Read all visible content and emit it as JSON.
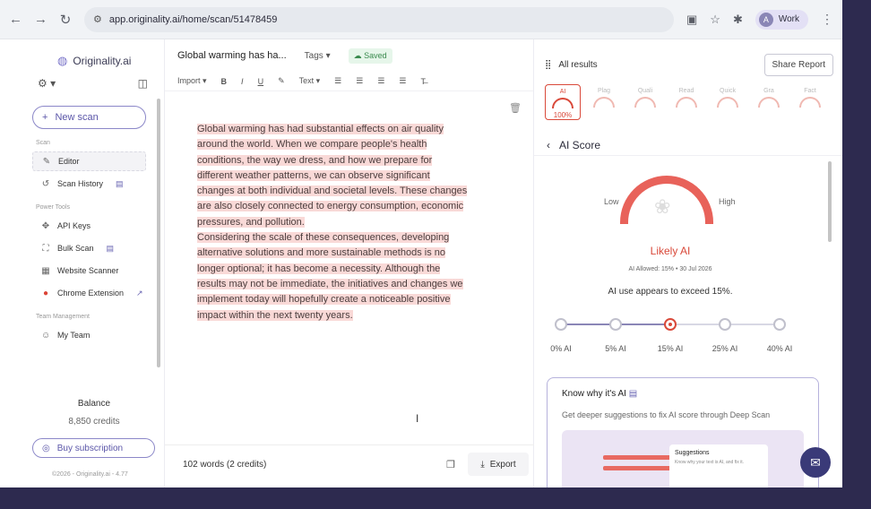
{
  "browser": {
    "url": "app.originality.ai/home/scan/51478459",
    "profile_initial": "A",
    "profile_name": "Work"
  },
  "sidebar": {
    "logo": "Originality.ai",
    "new_scan": "New scan",
    "section_scan": "Scan",
    "editor": "Editor",
    "scan_history": "Scan History",
    "section_power": "Power Tools",
    "api_keys": "API Keys",
    "bulk_scan": "Bulk Scan",
    "website_scanner": "Website Scanner",
    "chrome_extension": "Chrome Extension",
    "section_team": "Team Management",
    "my_team": "My Team",
    "balance_label": "Balance",
    "balance_value": "8,850 credits",
    "buy": "Buy subscription",
    "copyright": "©2026 - Originality.ai - 4.77"
  },
  "editor": {
    "title": "Global warming has ha...",
    "tags": "Tags",
    "saved": "Saved",
    "import": "Import",
    "text_style": "Text",
    "paragraphs": [
      [
        "Global warming has had substantial effects on air quality",
        "around the world. When we compare people's health",
        "conditions, the way we dress, and how we prepare for",
        "different weather patterns, we can observe significant",
        "changes at both individual and societal levels. These changes",
        "are also closely connected to energy consumption, economic",
        "pressures, and pollution."
      ],
      [
        "Considering the scale of these consequences, developing",
        "alternative solutions and more sustainable methods is no",
        "longer optional; it has become a necessity. Although the",
        "results may not be immediate, the initiatives and changes we",
        "implement today will hopefully create a noticeable positive",
        "impact within the next twenty years."
      ]
    ],
    "word_count": "102 words (2 credits)",
    "export": "Export"
  },
  "results": {
    "all_results": "All results",
    "share": "Share Report",
    "mini_gauges": [
      {
        "label": "AI",
        "value": "100%",
        "active": true
      },
      {
        "label": "Plag",
        "value": "",
        "active": false
      },
      {
        "label": "Quali",
        "value": "",
        "active": false
      },
      {
        "label": "Read",
        "value": "",
        "active": false
      },
      {
        "label": "Quick",
        "value": "",
        "active": false
      },
      {
        "label": "Gra",
        "value": "",
        "active": false
      },
      {
        "label": "Fact",
        "value": "",
        "active": false
      }
    ],
    "score_title": "AI Score",
    "low": "Low",
    "high": "High",
    "verdict": "Likely AI",
    "meta": "AI Allowed: 15%  •  30 Jul 2026",
    "exceed": "AI use appears to exceed 15%.",
    "threshold_index": 2,
    "stops": [
      "0% AI",
      "5% AI",
      "15% AI",
      "25% AI",
      "40% AI"
    ],
    "know_title": "Know why it's AI",
    "know_sub": "Get deeper suggestions to fix AI score through Deep Scan",
    "sugg_title": "Suggestions",
    "sugg_sub": "Know why your text is AI, and fix it."
  },
  "colors": {
    "accent": "#8b87c8",
    "alert": "#d9493a",
    "highlight": "#f9d9d7"
  }
}
